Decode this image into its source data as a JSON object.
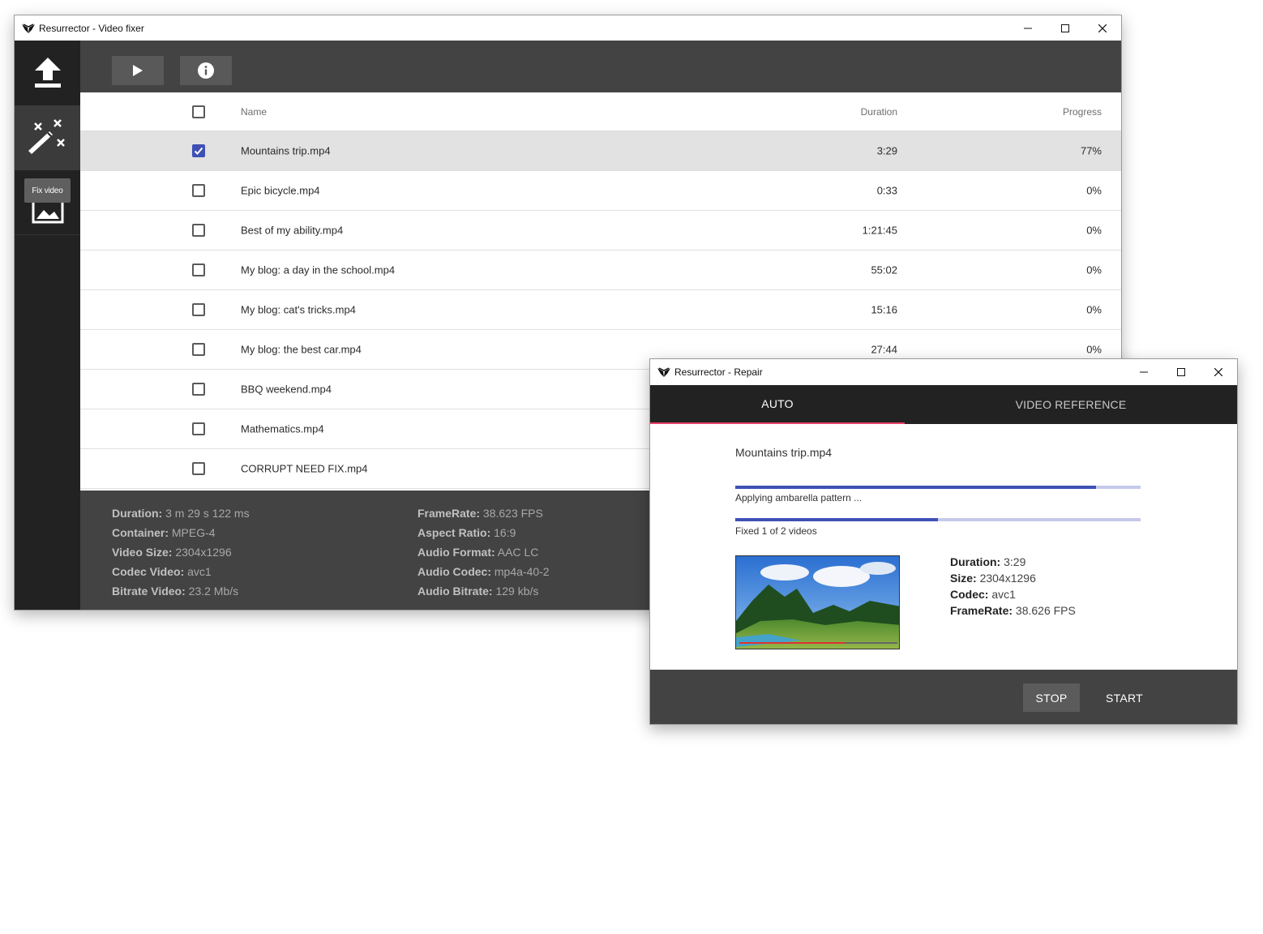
{
  "main_window": {
    "title": "Resurrector - Video fixer",
    "sidebar": {
      "tooltip": "Fix video"
    },
    "table": {
      "headers": {
        "name": "Name",
        "duration": "Duration",
        "progress": "Progress"
      },
      "rows": [
        {
          "name": "Mountains trip.mp4",
          "duration": "3:29",
          "progress": "77%",
          "checked": true
        },
        {
          "name": "Epic bicycle.mp4",
          "duration": "0:33",
          "progress": "0%",
          "checked": false
        },
        {
          "name": "Best of my ability.mp4",
          "duration": "1:21:45",
          "progress": "0%",
          "checked": false
        },
        {
          "name": "My blog: a day in the school.mp4",
          "duration": "55:02",
          "progress": "0%",
          "checked": false
        },
        {
          "name": "My blog: cat's tricks.mp4",
          "duration": "15:16",
          "progress": "0%",
          "checked": false
        },
        {
          "name": "My blog: the best car.mp4",
          "duration": "27:44",
          "progress": "0%",
          "checked": false
        },
        {
          "name": "BBQ weekend.mp4",
          "duration": "",
          "progress": "",
          "checked": false
        },
        {
          "name": "Mathematics.mp4",
          "duration": "",
          "progress": "",
          "checked": false
        },
        {
          "name": "CORRUPT NEED FIX.mp4",
          "duration": "",
          "progress": "",
          "checked": false
        }
      ]
    },
    "details": {
      "col1": [
        {
          "label": "Duration:",
          "value": "3 m 29 s 122 ms"
        },
        {
          "label": "Container:",
          "value": "MPEG-4"
        },
        {
          "label": "Video Size:",
          "value": "2304x1296"
        },
        {
          "label": "Codec Video:",
          "value": "avc1"
        },
        {
          "label": "Bitrate Video:",
          "value": "23.2 Mb/s"
        }
      ],
      "col2": [
        {
          "label": "FrameRate:",
          "value": "38.623 FPS"
        },
        {
          "label": "Aspect Ratio:",
          "value": "16:9"
        },
        {
          "label": "Audio Format:",
          "value": "AAC LC"
        },
        {
          "label": "Audio Codec:",
          "value": "mp4a-40-2"
        },
        {
          "label": "Audio Bitrate:",
          "value": "129 kb/s"
        }
      ]
    }
  },
  "repair_window": {
    "title": "Resurrector - Repair",
    "tabs": [
      {
        "label": "AUTO",
        "active": true
      },
      {
        "label": "VIDEO REFERENCE",
        "active": false
      }
    ],
    "file_name": "Mountains trip.mp4",
    "progress_step": {
      "label": "Applying ambarella pattern ...",
      "fraction": 0.89
    },
    "progress_total": {
      "label": "Fixed 1 of 2 videos",
      "fraction": 0.5
    },
    "meta": [
      {
        "label": "Duration:",
        "value": "3:29"
      },
      {
        "label": "Size:",
        "value": "2304x1296"
      },
      {
        "label": "Codec:",
        "value": "avc1"
      },
      {
        "label": "FrameRate:",
        "value": "38.626 FPS"
      }
    ],
    "buttons": {
      "stop": "STOP",
      "start": "START"
    }
  },
  "colors": {
    "accent": "#3f51b5",
    "tab_indicator": "#e9406a",
    "dark": "#222222",
    "panel": "#434343"
  }
}
